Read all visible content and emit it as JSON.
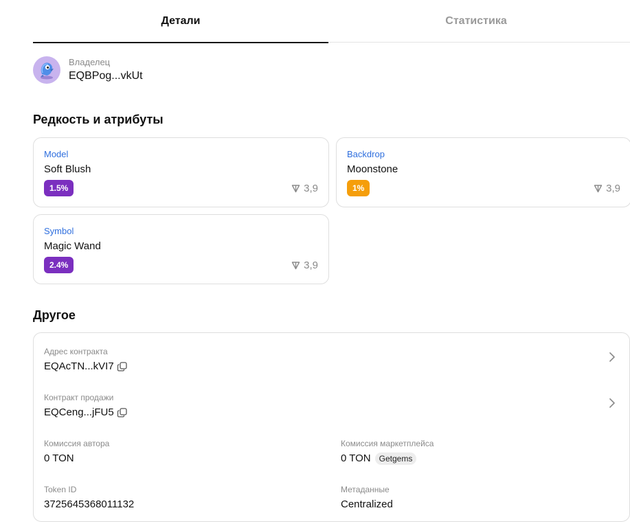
{
  "tabs": [
    {
      "label": "Детали"
    },
    {
      "label": "Статистика"
    }
  ],
  "owner": {
    "label": "Владелец",
    "address": "EQBPog...vkUt"
  },
  "rarity_section": {
    "title": "Редкость и атрибуты",
    "cards": [
      {
        "type": "Model",
        "value": "Soft Blush",
        "rarity": "1.5%",
        "rarity_color": "#7b2fbf",
        "price": "3,9"
      },
      {
        "type": "Backdrop",
        "value": "Moonstone",
        "rarity": "1%",
        "rarity_color": "#f59e0b",
        "price": "3,9"
      },
      {
        "type": "Symbol",
        "value": "Magic Wand",
        "rarity": "2.4%",
        "rarity_color": "#7b2fbf",
        "price": "3,9"
      }
    ]
  },
  "other_section": {
    "title": "Другое",
    "contract_address": {
      "label": "Адрес контракта",
      "value": "EQAcTN...kVI7"
    },
    "sale_contract": {
      "label": "Контракт продажи",
      "value": "EQCeng...jFU5"
    },
    "author_fee": {
      "label": "Комиссия автора",
      "value": "0 TON"
    },
    "marketplace_fee": {
      "label": "Комиссия маркетплейса",
      "value": "0 TON",
      "tag": "Getgems"
    },
    "token_id": {
      "label": "Token ID",
      "value": "3725645368011132"
    },
    "metadata": {
      "label": "Метаданные",
      "value": "Centralized"
    }
  },
  "colors": {
    "accent_blue": "#2f6fde",
    "text": "#111111",
    "muted": "#8a8a8a",
    "border": "#dedede"
  }
}
